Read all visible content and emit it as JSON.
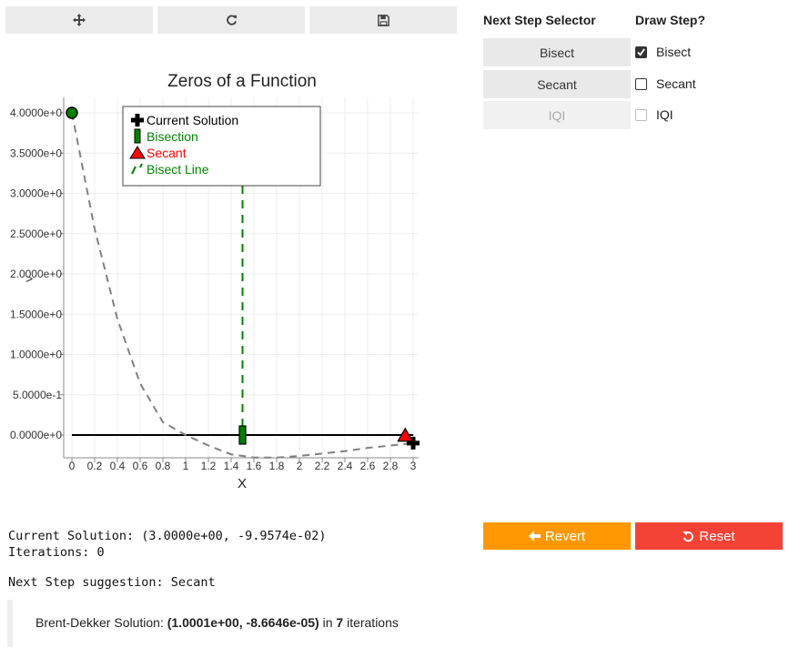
{
  "toolbar": {
    "pan_icon": "move-icon",
    "refresh_icon": "refresh-icon",
    "save_icon": "save-icon"
  },
  "plot": {
    "cursor_glyph": ">"
  },
  "chart_data": {
    "type": "line",
    "title": "Zeros of a Function",
    "xlabel": "X",
    "ylabel": "",
    "xlim": [
      -0.1,
      3.05
    ],
    "ylim": [
      -0.28,
      4.2
    ],
    "grid": true,
    "legend_position": "top-center",
    "x_ticks": [
      "0",
      "0.2",
      "0.4",
      "0.6",
      "0.8",
      "1",
      "1.2",
      "1.4",
      "1.6",
      "1.8",
      "2",
      "2.2",
      "2.4",
      "2.6",
      "2.8",
      "3"
    ],
    "y_ticks": [
      "0.0000e+0",
      "5.0000e-1",
      "1.0000e+0",
      "1.5000e+0",
      "2.0000e+0",
      "2.5000e+0",
      "3.0000e+0",
      "3.5000e+0",
      "4.0000e+0"
    ],
    "y_tick_values": [
      0,
      0.5,
      1,
      1.5,
      2,
      2.5,
      3,
      3.5,
      4
    ],
    "function_curve": {
      "x": [
        0,
        0.2,
        0.4,
        0.6,
        0.8,
        1.0,
        1.2,
        1.4,
        1.6,
        1.8,
        2.0,
        2.2,
        2.4,
        2.6,
        2.8,
        3.0
      ],
      "y": [
        4.0,
        2.56,
        1.44,
        0.64,
        0.16,
        0.0,
        -0.13,
        -0.24,
        -0.28,
        -0.28,
        -0.26,
        -0.23,
        -0.2,
        -0.16,
        -0.13,
        -0.1
      ],
      "color": "#808080"
    },
    "zero_line": {
      "x": [
        0,
        3
      ],
      "y": [
        0,
        0
      ],
      "color": "#000000"
    },
    "bisect_line": {
      "x": 1.5,
      "color": "#008000"
    },
    "series": [
      {
        "name": "Current Solution",
        "x": [
          3.0
        ],
        "y": [
          -0.1
        ],
        "color": "#000000",
        "marker": "cross"
      },
      {
        "name": "Bisection",
        "x": [
          1.5
        ],
        "y": [
          0.0
        ],
        "color": "#008000",
        "marker": "bar"
      },
      {
        "name": "Secant",
        "x": [
          2.93
        ],
        "y": [
          -0.02
        ],
        "color": "#ff0000",
        "marker": "triangle"
      },
      {
        "name": "Bisect Line",
        "color": "#008000",
        "marker": "dash"
      }
    ],
    "start_point": {
      "x": 0,
      "y": 4.0,
      "color": "#008000"
    }
  },
  "selector": {
    "title": "Next Step Selector",
    "buttons": [
      "Bisect",
      "Secant",
      "IQI"
    ]
  },
  "draw": {
    "title": "Draw Step?",
    "items": [
      {
        "label": "Bisect",
        "checked": true,
        "disabled": false
      },
      {
        "label": "Secant",
        "checked": false,
        "disabled": false
      },
      {
        "label": "IQI",
        "checked": false,
        "disabled": true
      }
    ]
  },
  "actions": {
    "revert_label": "Revert",
    "reset_label": "Reset",
    "revert_color": "#ff9800",
    "reset_color": "#f44336"
  },
  "status": {
    "current_solution": "Current Solution: (3.0000e+00, -9.9574e-02)",
    "iterations": "Iterations: 0",
    "suggestion": "Next Step suggestion: Secant"
  },
  "brent": {
    "prefix": "Brent-Dekker Solution: ",
    "solution": "(1.0001e+00, -8.6646e-05)",
    "middle": " in ",
    "iterations": "7",
    "suffix": " iterations"
  }
}
